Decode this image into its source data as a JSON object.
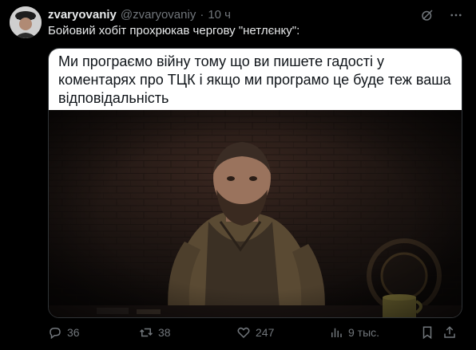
{
  "author": {
    "display_name": "zvaryovaniy",
    "handle": "@zvaryovaniy",
    "separator": "·",
    "time": "10 ч"
  },
  "tweet": {
    "text": "Бойовий хобіт прохрюкав чергову \"нетлєнку\":"
  },
  "media": {
    "caption_lines": [
      "Ми програємо війну тому що ви пишете гадості у",
      "коментарях про ТЦК і якщо ми програмо це буде теж ваша",
      "відповідальність"
    ]
  },
  "actions": {
    "replies": "36",
    "reposts": "38",
    "likes": "247",
    "views": "9 тыс."
  },
  "icons": {
    "top": [
      "grok-icon",
      "more-icon"
    ],
    "bottom": [
      "reply-icon",
      "repost-icon",
      "like-icon",
      "views-icon",
      "bookmark-icon",
      "share-icon"
    ]
  },
  "colors": {
    "background": "#000000",
    "text": "#e7e9ea",
    "muted": "#71767b",
    "caption_bg": "#ffffff"
  }
}
